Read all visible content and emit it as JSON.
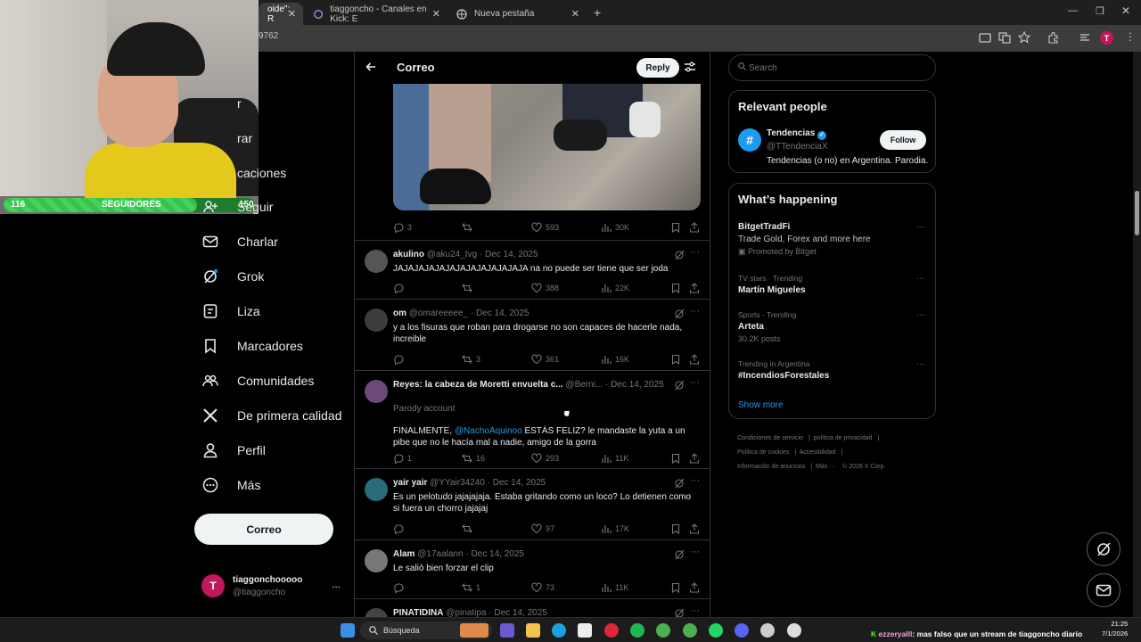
{
  "browser": {
    "tabs": [
      {
        "title": "oide\": R"
      },
      {
        "title": "tiaggoncho - Canales en Kick: E"
      },
      {
        "title": "Nueva pestaña"
      }
    ],
    "url_fragment": "9762"
  },
  "stream_overlay": {
    "followers_current": "116",
    "followers_label": "SEGUIDORES",
    "followers_goal": "150",
    "followers_progress": 0.77
  },
  "nav": {
    "items": [
      {
        "label": "r"
      },
      {
        "label": "rar"
      },
      {
        "label": "caciones"
      },
      {
        "label": "Seguir"
      },
      {
        "label": "Charlar"
      },
      {
        "label": "Grok"
      },
      {
        "label": "Liza"
      },
      {
        "label": "Marcadores"
      },
      {
        "label": "Comunidades"
      },
      {
        "label": "De primera calidad"
      },
      {
        "label": "Perfil"
      },
      {
        "label": "Más"
      }
    ],
    "post_button": "Correo",
    "profile": {
      "initial": "T",
      "name": "tiaggonchooooo",
      "handle": "@tiaggoncho",
      "more": "..."
    }
  },
  "feed": {
    "title": "Correo",
    "reply_button": "Reply",
    "main_actions": {
      "replies": "3",
      "reposts": "",
      "likes": "593",
      "views": "30K"
    },
    "posts": [
      {
        "name": "akulino",
        "handle": "@aku24_tvg",
        "date": "Dec 14, 2025",
        "text": "JAJAJAJAJAJAJAJAJAJAJAJAJA na no puede ser tiene que ser joda",
        "replies": "",
        "reposts": "",
        "likes": "388",
        "views": "22K"
      },
      {
        "name": "om",
        "handle": "@omareeeee_",
        "date": "Dec 14, 2025",
        "text": "y a los fisuras que roban para drogarse no son capaces de hacerle nada, increible",
        "replies": "",
        "reposts": "3",
        "likes": "361",
        "views": "16K"
      },
      {
        "name": "Reyes: la cabeza de Moretti envuelta c...",
        "handle": "@Berni...",
        "date": "Dec 14, 2025",
        "sub": "Parody account",
        "mention": "@NachoAquinoo",
        "text_pre": "FINALMENTE, ",
        "text_post": " ESTÁS FELIZ? le mandaste la yuta a un pibe que no le hacía mal a nadie, amigo de la gorra",
        "replies": "1",
        "reposts": "16",
        "likes": "293",
        "views": "11K"
      },
      {
        "name": "yair yair",
        "handle": "@YYair34240",
        "date": "Dec 14, 2025",
        "text": "Es un pelotudo jajajajaja. Estaba gritando como un loco? Lo detienen como si fuera un chorro jajajaj",
        "replies": "",
        "reposts": "",
        "likes": "97",
        "views": "17K"
      },
      {
        "name": "Alam",
        "handle": "@17aalann",
        "date": "Dec 14, 2025",
        "text": "Le salió bien forzar el clip",
        "replies": "",
        "reposts": "1",
        "likes": "73",
        "views": "11K"
      },
      {
        "name": "PINATIDINA",
        "handle": "@pinatipa",
        "date": "Dec 14, 2025"
      }
    ]
  },
  "right": {
    "search_placeholder": "Search",
    "relevant": {
      "title": "Relevant people",
      "name": "Tendencias",
      "handle": "@TTendenciaX",
      "bio": "Tendencias (o no) en Argentina. Parodia.",
      "follow": "Follow",
      "avatar_glyph": "#"
    },
    "happening": {
      "title": "What’s happening",
      "trends": [
        {
          "context": "",
          "topic": "BitgetTradFi",
          "extra": "Trade Gold, Forex and more here",
          "promo": "Promoted by Bitget"
        },
        {
          "context": "TV stars · Trending",
          "topic": "Martín Migueles",
          "extra": ""
        },
        {
          "context": "Sports · Trending",
          "topic": "Arteta",
          "extra": "30.2K posts"
        },
        {
          "context": "Trending in Argentina",
          "topic": "#IncendiosForestales",
          "extra": ""
        }
      ],
      "show_more": "Show more"
    },
    "footer": [
      "Condiciones de servicio",
      "política de privacidad",
      "Política de cookies",
      "Accesibilidad",
      "Información de anuncios",
      "Más ···",
      "© 2026 X Corp."
    ]
  },
  "taskbar": {
    "search": "Búsqueda",
    "chat_user": "ezzeryalll",
    "chat_msg": ": mas falso que un stream de tiaggoncho diario",
    "time": "21:25",
    "date": "7/1/2026"
  },
  "colors": {
    "accent": "#1d9bf0",
    "border": "#2f3336",
    "muted": "#71767b",
    "kick_green": "#53fc18"
  }
}
